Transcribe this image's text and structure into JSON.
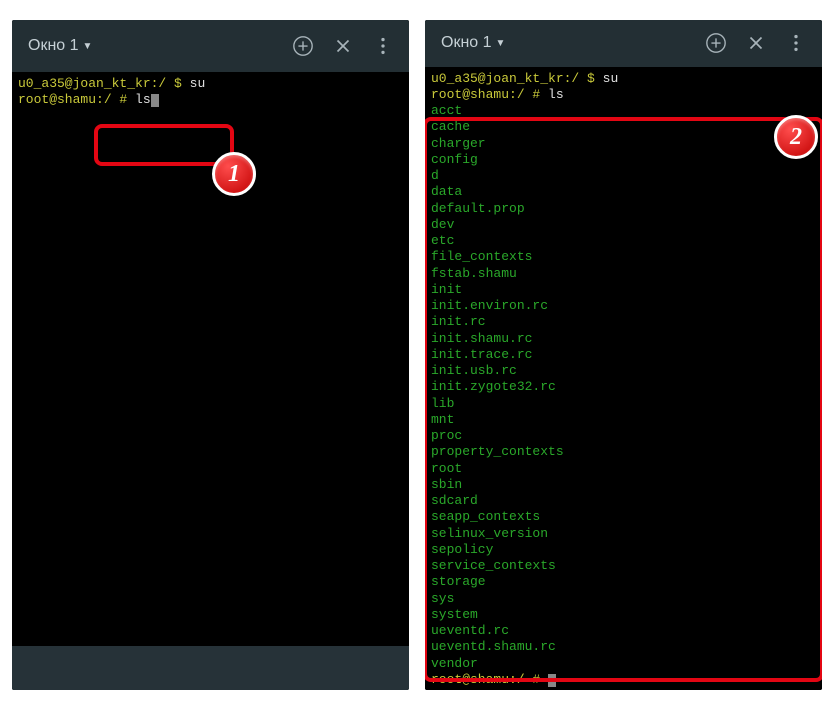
{
  "left": {
    "tab": "Окно 1",
    "lines": {
      "l1_user": "u0_a35@joan_kt_kr:/ $ ",
      "l1_cmd": "su",
      "l2_user": "root@shamu:/ # ",
      "l2_cmd": "ls"
    },
    "badge": "1"
  },
  "right": {
    "tab": "Окно 1",
    "lines": {
      "l1_user": "u0_a35@joan_kt_kr:/ $ ",
      "l1_cmd": "su",
      "l2_user": "root@shamu:/ # ",
      "l2_cmd": "ls",
      "files": [
        "acct",
        "cache",
        "charger",
        "config",
        "d",
        "data",
        "default.prop",
        "dev",
        "etc",
        "file_contexts",
        "fstab.shamu",
        "init",
        "init.environ.rc",
        "init.rc",
        "init.shamu.rc",
        "init.trace.rc",
        "init.usb.rc",
        "init.zygote32.rc",
        "lib",
        "mnt",
        "proc",
        "property_contexts",
        "root",
        "sbin",
        "sdcard",
        "seapp_contexts",
        "selinux_version",
        "sepolicy",
        "service_contexts",
        "storage",
        "sys",
        "system",
        "ueventd.rc",
        "ueventd.shamu.rc",
        "vendor"
      ],
      "prompt_user": "root@shamu:/ # "
    },
    "badge": "2"
  }
}
